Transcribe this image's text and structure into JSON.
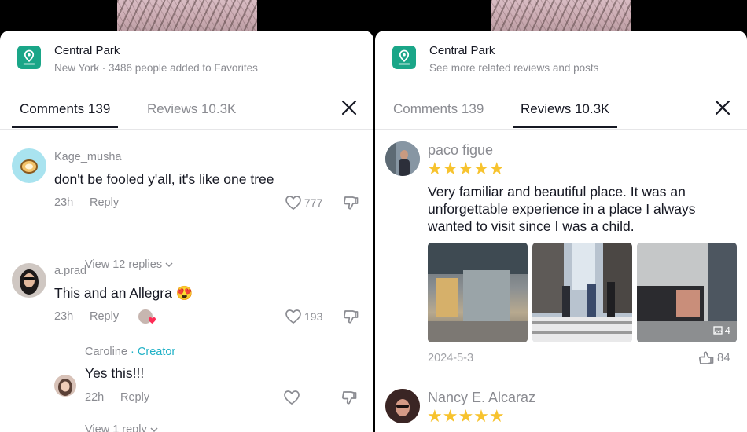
{
  "left": {
    "location": {
      "title": "Central Park",
      "subtitle": "New York · 3486 people added to Favorites"
    },
    "tabs": [
      {
        "label": "Comments 139"
      },
      {
        "label": "Reviews 10.3K"
      }
    ],
    "comments": [
      {
        "username": "Kage_musha",
        "text": "don't be fooled y'all, it's like one tree",
        "time": "23h",
        "reply": "Reply",
        "likes": "777",
        "view_replies": "View 12 replies"
      },
      {
        "username": "a.prad",
        "text": "This and an Allegra",
        "emoji": "😍",
        "time": "23h",
        "reply": "Reply",
        "likes": "193"
      },
      {
        "username": "Caroline",
        "creator_badge": "· Creator",
        "text": "Yes this!!!",
        "time": "22h",
        "reply": "Reply",
        "view_replies": "View 1 reply"
      }
    ]
  },
  "right": {
    "location": {
      "title": "Central Park",
      "subtitle": "See more related reviews and posts"
    },
    "tabs": [
      {
        "label": "Comments 139"
      },
      {
        "label": "Reviews 10.3K"
      }
    ],
    "reviews": [
      {
        "username": "paco figue",
        "rating": 5,
        "stars": "★★★★★",
        "text": "Very familiar and beautiful place. It was an unforgettable experience in a place I always wanted to visit since I was a child.",
        "date": "2024-5-3",
        "likes": "84",
        "image_count": "4"
      },
      {
        "username": "Nancy E. Alcaraz",
        "rating": 5,
        "stars": "★★★★★"
      }
    ]
  },
  "colors": {
    "accent_teal": "#1aa688",
    "creator": "#20b1c6",
    "star": "#f7c32e",
    "text": "#161823",
    "muted": "#8a8b91"
  }
}
